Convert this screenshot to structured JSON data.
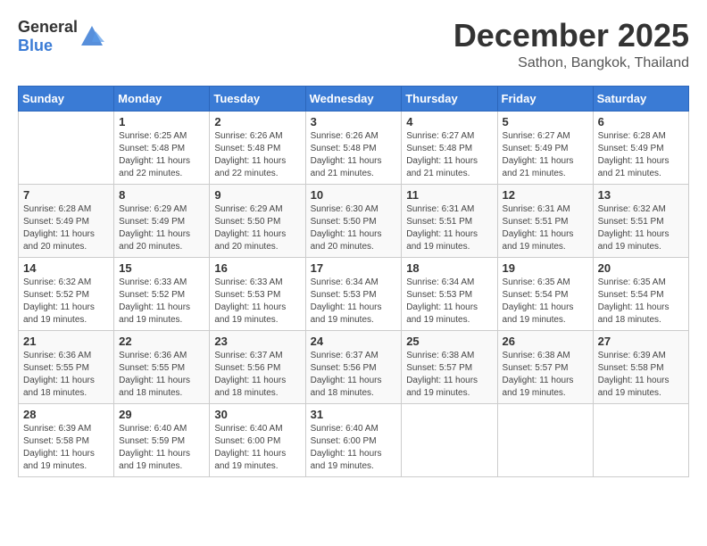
{
  "header": {
    "logo_general": "General",
    "logo_blue": "Blue",
    "month": "December 2025",
    "location": "Sathon, Bangkok, Thailand"
  },
  "weekdays": [
    "Sunday",
    "Monday",
    "Tuesday",
    "Wednesday",
    "Thursday",
    "Friday",
    "Saturday"
  ],
  "weeks": [
    [
      {
        "day": "",
        "sunrise": "",
        "sunset": "",
        "daylight": ""
      },
      {
        "day": "1",
        "sunrise": "Sunrise: 6:25 AM",
        "sunset": "Sunset: 5:48 PM",
        "daylight": "Daylight: 11 hours and 22 minutes."
      },
      {
        "day": "2",
        "sunrise": "Sunrise: 6:26 AM",
        "sunset": "Sunset: 5:48 PM",
        "daylight": "Daylight: 11 hours and 22 minutes."
      },
      {
        "day": "3",
        "sunrise": "Sunrise: 6:26 AM",
        "sunset": "Sunset: 5:48 PM",
        "daylight": "Daylight: 11 hours and 21 minutes."
      },
      {
        "day": "4",
        "sunrise": "Sunrise: 6:27 AM",
        "sunset": "Sunset: 5:48 PM",
        "daylight": "Daylight: 11 hours and 21 minutes."
      },
      {
        "day": "5",
        "sunrise": "Sunrise: 6:27 AM",
        "sunset": "Sunset: 5:49 PM",
        "daylight": "Daylight: 11 hours and 21 minutes."
      },
      {
        "day": "6",
        "sunrise": "Sunrise: 6:28 AM",
        "sunset": "Sunset: 5:49 PM",
        "daylight": "Daylight: 11 hours and 21 minutes."
      }
    ],
    [
      {
        "day": "7",
        "sunrise": "Sunrise: 6:28 AM",
        "sunset": "Sunset: 5:49 PM",
        "daylight": "Daylight: 11 hours and 20 minutes."
      },
      {
        "day": "8",
        "sunrise": "Sunrise: 6:29 AM",
        "sunset": "Sunset: 5:49 PM",
        "daylight": "Daylight: 11 hours and 20 minutes."
      },
      {
        "day": "9",
        "sunrise": "Sunrise: 6:29 AM",
        "sunset": "Sunset: 5:50 PM",
        "daylight": "Daylight: 11 hours and 20 minutes."
      },
      {
        "day": "10",
        "sunrise": "Sunrise: 6:30 AM",
        "sunset": "Sunset: 5:50 PM",
        "daylight": "Daylight: 11 hours and 20 minutes."
      },
      {
        "day": "11",
        "sunrise": "Sunrise: 6:31 AM",
        "sunset": "Sunset: 5:51 PM",
        "daylight": "Daylight: 11 hours and 19 minutes."
      },
      {
        "day": "12",
        "sunrise": "Sunrise: 6:31 AM",
        "sunset": "Sunset: 5:51 PM",
        "daylight": "Daylight: 11 hours and 19 minutes."
      },
      {
        "day": "13",
        "sunrise": "Sunrise: 6:32 AM",
        "sunset": "Sunset: 5:51 PM",
        "daylight": "Daylight: 11 hours and 19 minutes."
      }
    ],
    [
      {
        "day": "14",
        "sunrise": "Sunrise: 6:32 AM",
        "sunset": "Sunset: 5:52 PM",
        "daylight": "Daylight: 11 hours and 19 minutes."
      },
      {
        "day": "15",
        "sunrise": "Sunrise: 6:33 AM",
        "sunset": "Sunset: 5:52 PM",
        "daylight": "Daylight: 11 hours and 19 minutes."
      },
      {
        "day": "16",
        "sunrise": "Sunrise: 6:33 AM",
        "sunset": "Sunset: 5:53 PM",
        "daylight": "Daylight: 11 hours and 19 minutes."
      },
      {
        "day": "17",
        "sunrise": "Sunrise: 6:34 AM",
        "sunset": "Sunset: 5:53 PM",
        "daylight": "Daylight: 11 hours and 19 minutes."
      },
      {
        "day": "18",
        "sunrise": "Sunrise: 6:34 AM",
        "sunset": "Sunset: 5:53 PM",
        "daylight": "Daylight: 11 hours and 19 minutes."
      },
      {
        "day": "19",
        "sunrise": "Sunrise: 6:35 AM",
        "sunset": "Sunset: 5:54 PM",
        "daylight": "Daylight: 11 hours and 19 minutes."
      },
      {
        "day": "20",
        "sunrise": "Sunrise: 6:35 AM",
        "sunset": "Sunset: 5:54 PM",
        "daylight": "Daylight: 11 hours and 18 minutes."
      }
    ],
    [
      {
        "day": "21",
        "sunrise": "Sunrise: 6:36 AM",
        "sunset": "Sunset: 5:55 PM",
        "daylight": "Daylight: 11 hours and 18 minutes."
      },
      {
        "day": "22",
        "sunrise": "Sunrise: 6:36 AM",
        "sunset": "Sunset: 5:55 PM",
        "daylight": "Daylight: 11 hours and 18 minutes."
      },
      {
        "day": "23",
        "sunrise": "Sunrise: 6:37 AM",
        "sunset": "Sunset: 5:56 PM",
        "daylight": "Daylight: 11 hours and 18 minutes."
      },
      {
        "day": "24",
        "sunrise": "Sunrise: 6:37 AM",
        "sunset": "Sunset: 5:56 PM",
        "daylight": "Daylight: 11 hours and 18 minutes."
      },
      {
        "day": "25",
        "sunrise": "Sunrise: 6:38 AM",
        "sunset": "Sunset: 5:57 PM",
        "daylight": "Daylight: 11 hours and 19 minutes."
      },
      {
        "day": "26",
        "sunrise": "Sunrise: 6:38 AM",
        "sunset": "Sunset: 5:57 PM",
        "daylight": "Daylight: 11 hours and 19 minutes."
      },
      {
        "day": "27",
        "sunrise": "Sunrise: 6:39 AM",
        "sunset": "Sunset: 5:58 PM",
        "daylight": "Daylight: 11 hours and 19 minutes."
      }
    ],
    [
      {
        "day": "28",
        "sunrise": "Sunrise: 6:39 AM",
        "sunset": "Sunset: 5:58 PM",
        "daylight": "Daylight: 11 hours and 19 minutes."
      },
      {
        "day": "29",
        "sunrise": "Sunrise: 6:40 AM",
        "sunset": "Sunset: 5:59 PM",
        "daylight": "Daylight: 11 hours and 19 minutes."
      },
      {
        "day": "30",
        "sunrise": "Sunrise: 6:40 AM",
        "sunset": "Sunset: 6:00 PM",
        "daylight": "Daylight: 11 hours and 19 minutes."
      },
      {
        "day": "31",
        "sunrise": "Sunrise: 6:40 AM",
        "sunset": "Sunset: 6:00 PM",
        "daylight": "Daylight: 11 hours and 19 minutes."
      },
      {
        "day": "",
        "sunrise": "",
        "sunset": "",
        "daylight": ""
      },
      {
        "day": "",
        "sunrise": "",
        "sunset": "",
        "daylight": ""
      },
      {
        "day": "",
        "sunrise": "",
        "sunset": "",
        "daylight": ""
      }
    ]
  ]
}
